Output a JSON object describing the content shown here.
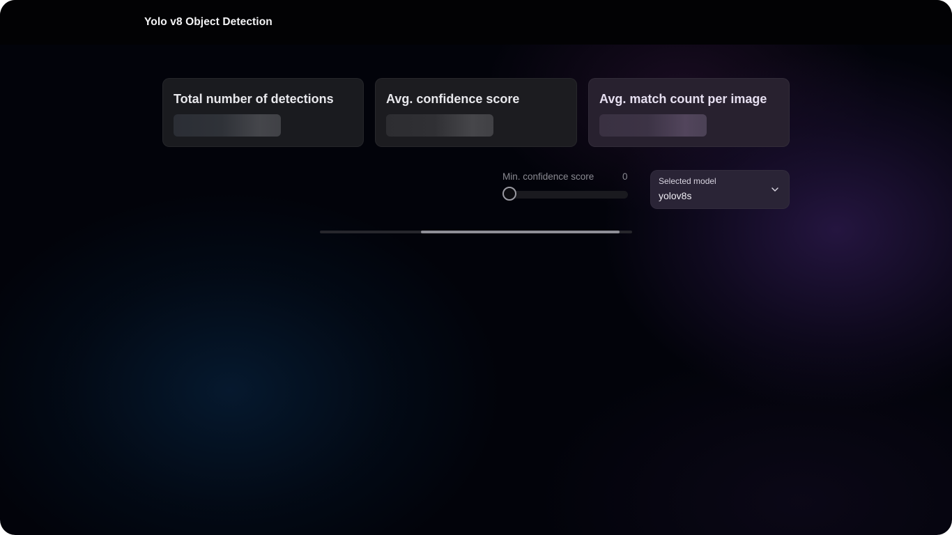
{
  "app": {
    "title": "Yolo v8 Object Detection"
  },
  "stats": [
    {
      "title": "Total number of detections"
    },
    {
      "title": "Avg. confidence score"
    },
    {
      "title": "Avg. match count per image"
    }
  ],
  "confidence": {
    "label": "Min. confidence score",
    "value": "0"
  },
  "model": {
    "label": "Selected model",
    "value": "yolov8s",
    "icon": "chevron-down-icon"
  },
  "colors": {
    "background": "#02030a",
    "card": "#1a1b1f",
    "card_accent": "#28212f",
    "select": "#2a2436"
  }
}
